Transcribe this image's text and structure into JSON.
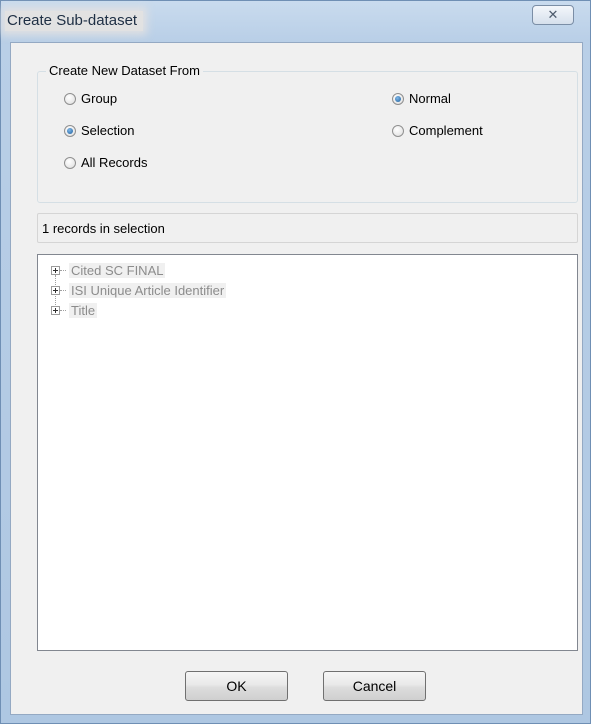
{
  "window": {
    "title": "Create Sub-dataset",
    "close_glyph": "☒"
  },
  "group": {
    "legend": "Create New Dataset From",
    "source_options": [
      {
        "label": "Group",
        "checked": false
      },
      {
        "label": "Selection",
        "checked": true
      },
      {
        "label": "All Records",
        "checked": false
      }
    ],
    "mode_options": [
      {
        "label": "Normal",
        "checked": true
      },
      {
        "label": "Complement",
        "checked": false
      }
    ]
  },
  "status": {
    "text": "1 records in selection"
  },
  "tree": {
    "items": [
      {
        "label": "Cited SC FINAL"
      },
      {
        "label": "ISI Unique Article Identifier"
      },
      {
        "label": "Title"
      }
    ]
  },
  "buttons": {
    "ok": "OK",
    "cancel": "Cancel"
  },
  "icons": {
    "close": "close-icon",
    "expand": "plus-box-icon"
  }
}
